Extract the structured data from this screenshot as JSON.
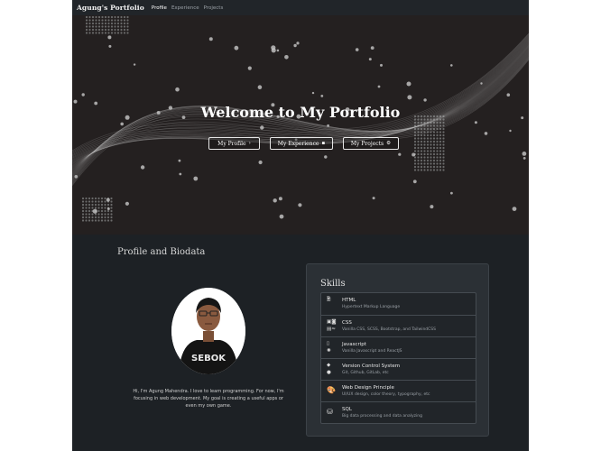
{
  "nav": {
    "brand": "Agung's Portfolio",
    "links": [
      "Profile",
      "Experience",
      "Projects"
    ]
  },
  "hero": {
    "title": "Welcome to My Portfolio",
    "buttons": [
      {
        "label": "My Profile",
        "icon": "arrow-right-icon"
      },
      {
        "label": "My Experience",
        "icon": "briefcase-icon"
      },
      {
        "label": "My Projects",
        "icon": "gear-icon"
      }
    ]
  },
  "profile": {
    "section_title": "Profile and Biodata",
    "bio": "Hi, I'm Agung Mahendra. I love to learn programming. For now, I'm focusing in web development. My goal is creating a useful apps or even my own game.",
    "shirt_text": "SEBOK"
  },
  "skills": {
    "title": "Skills",
    "items": [
      {
        "name": "HTML",
        "desc": "Hypertext Markup Language",
        "icons": [
          "html-file-icon"
        ]
      },
      {
        "name": "CSS",
        "desc": "Vanilla CSS, SCSS, Bootstrap, and TailwindCSS",
        "icons": [
          "css-icon",
          "sass-icon",
          "bootstrap-icon",
          "tailwind-icon"
        ]
      },
      {
        "name": "Javascript",
        "desc": "Vanilla Javascript and ReactJS",
        "icons": [
          "javascript-icon",
          "react-icon"
        ]
      },
      {
        "name": "Version Control System",
        "desc": "Git, Github, GitLab, etc",
        "icons": [
          "git-icon",
          "github-icon"
        ]
      },
      {
        "name": "Web Design Principle",
        "desc": "UI/UX design, color theory, typography, etc",
        "icons": [
          "palette-icon"
        ]
      },
      {
        "name": "SQL",
        "desc": "Big data processing and data analyzing",
        "icons": [
          "database-icon"
        ]
      }
    ]
  },
  "colors": {
    "page_bg": "#1d2125",
    "navbar_bg": "#212529",
    "hero_bg": "#242020",
    "card_bg": "#2b3035"
  }
}
